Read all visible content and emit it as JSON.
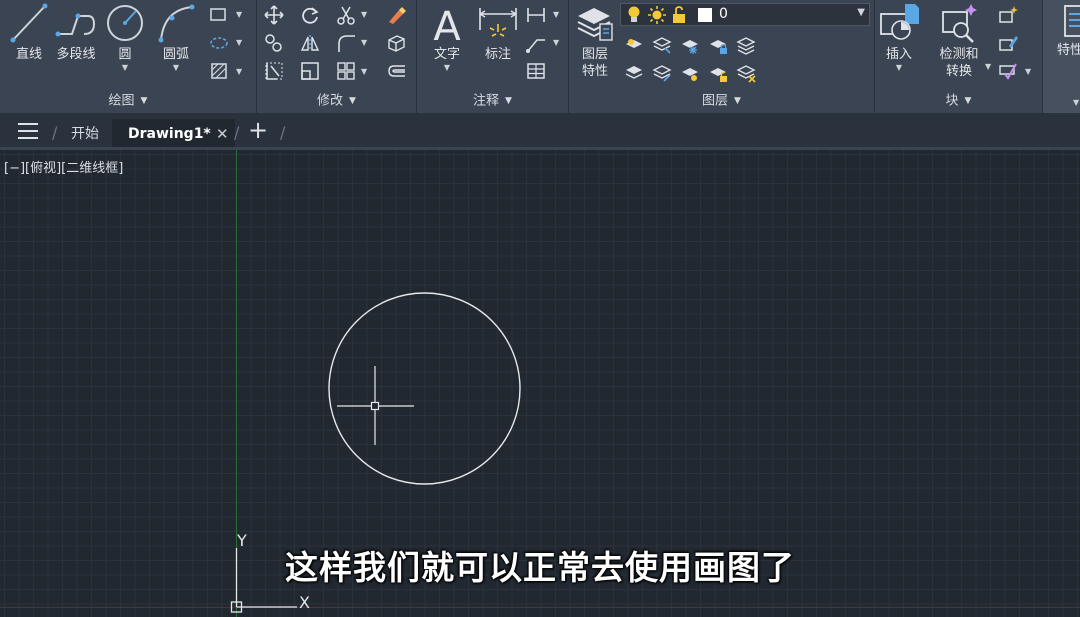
{
  "ribbon": {
    "draw": {
      "title": "绘图",
      "line_label": "直线",
      "polyline_label": "多段线",
      "circle_label": "圆",
      "arc_label": "圆弧"
    },
    "modify": {
      "title": "修改"
    },
    "annotation": {
      "title": "注释",
      "text_label": "文字",
      "dimension_label": "标注"
    },
    "layers": {
      "title": "图层",
      "properties_label_1": "图层",
      "properties_label_2": "特性",
      "current_layer": "0"
    },
    "block": {
      "title": "块",
      "insert_label": "插入",
      "detect_label_1": "检测和",
      "detect_label_2": "转换"
    },
    "properties": {
      "label": "特性"
    }
  },
  "tabs": {
    "start_label": "开始",
    "drawing_label": "Drawing1*",
    "close_glyph": "✕",
    "new_glyph": "+"
  },
  "viewport": {
    "label": "[−][俯视][二维线框]"
  },
  "ucs": {
    "x_label": "X",
    "y_label": "Y"
  },
  "subtitle": "这样我们就可以正常去使用画图了",
  "colors": {
    "ribbon_bg": "#3b4453",
    "canvas_bg": "#212830",
    "accent_blue": "#5aa7e6",
    "layer_yellow": "#f5c935"
  }
}
